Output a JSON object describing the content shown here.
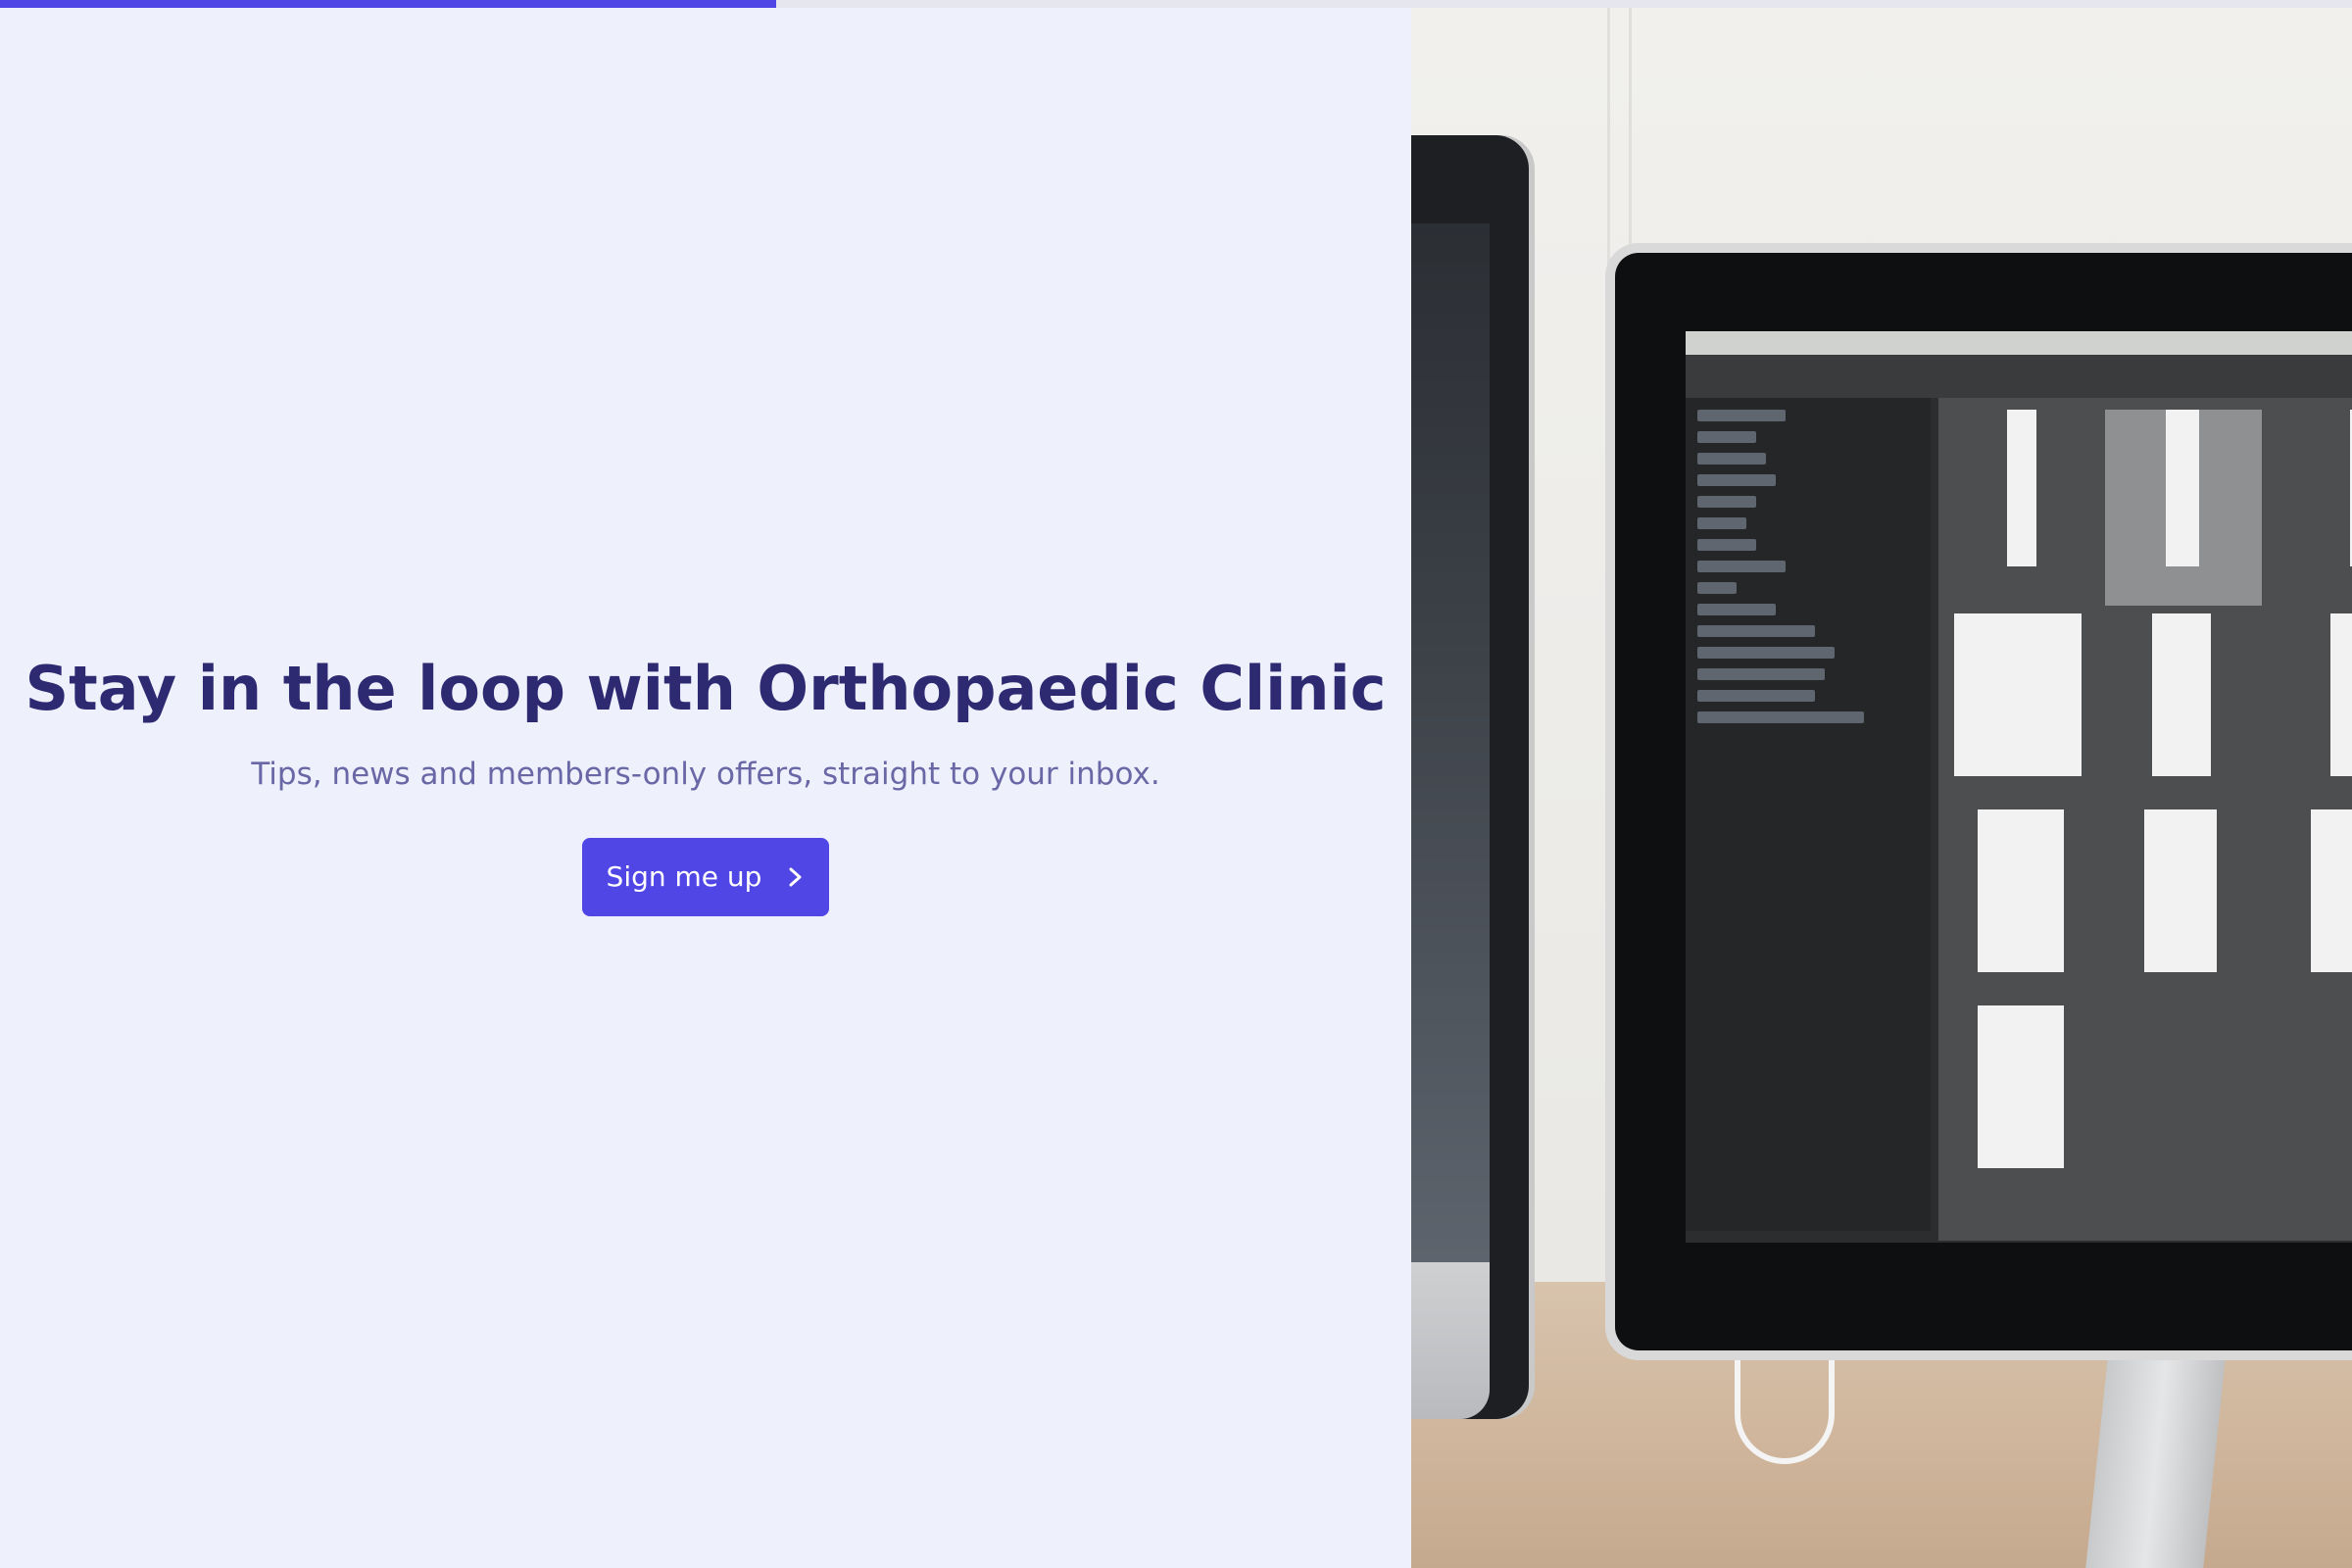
{
  "progress": {
    "value_percent": 33,
    "fill_color": "#4f46e5"
  },
  "signup": {
    "headline": "Stay in the loop with Orthopaedic Clinic",
    "subtext": "Tips, news and members-only offers, straight to your inbox.",
    "button_label": "Sign me up",
    "button_icon": "chevron-right-icon",
    "accent_color": "#4f46e5",
    "headline_color": "#2e2a72"
  },
  "hero_image": {
    "subject": "two desktop monitors showing a file browser"
  }
}
